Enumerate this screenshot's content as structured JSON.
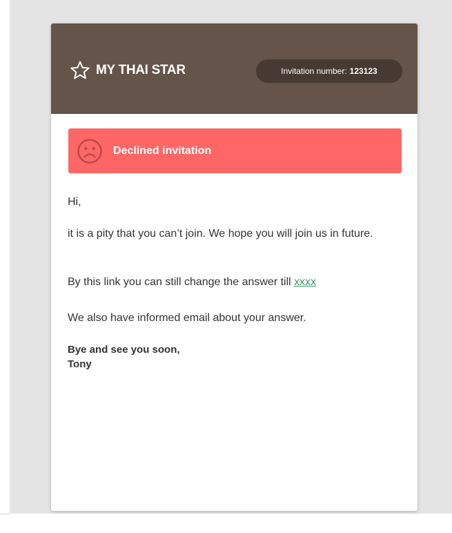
{
  "header": {
    "brand_name": "MY THAI STAR",
    "invitation_label": "Invitation number:",
    "invitation_number": "123123"
  },
  "alert": {
    "label": "Declined invitation",
    "icon": "sad-face-icon",
    "color": "#ff6666"
  },
  "message": {
    "greeting": "Hi,",
    "pity_text": "it is a pity that you can’t join. We hope you will join us in future.",
    "link_prefix": "By this link you can still change the answer till ",
    "link_text": "xxxx",
    "informed_text": "We also have informed email about your answer.",
    "closing": "Bye and see you soon,",
    "signature": "Tony"
  },
  "colors": {
    "header_bg": "#645449",
    "pill_bg": "#463a33",
    "link": "#3a9b6a",
    "backdrop": "#e4e4e4"
  }
}
